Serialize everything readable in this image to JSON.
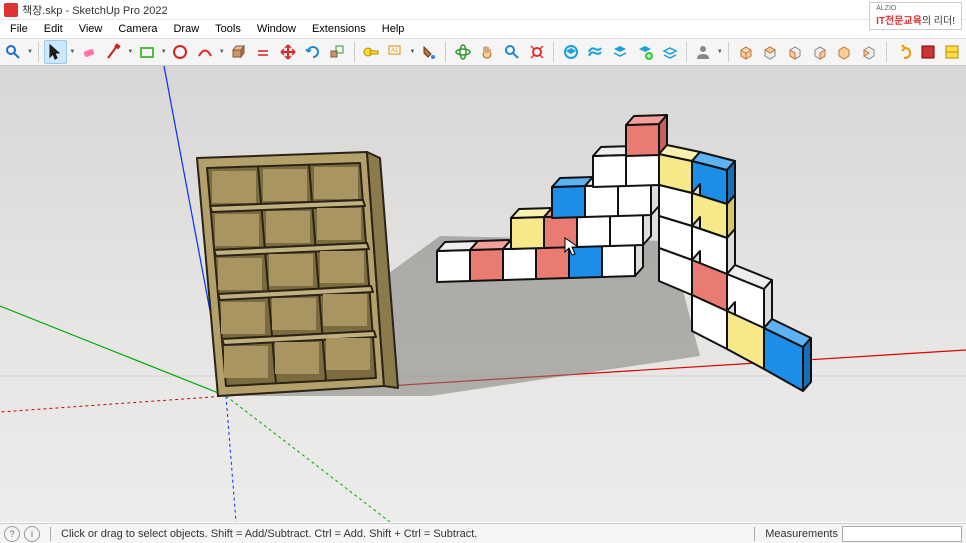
{
  "app": {
    "title": "책장.skp - SketchUp Pro 2022"
  },
  "watermark": {
    "small": "ALZIO",
    "brand": "IT전문교육",
    "tagline": "의 리더!"
  },
  "menu": {
    "items": [
      "File",
      "Edit",
      "View",
      "Camera",
      "Draw",
      "Tools",
      "Window",
      "Extensions",
      "Help"
    ]
  },
  "toolbar": {
    "icons": [
      "search-icon",
      "select-icon",
      "eraser-icon",
      "line-icon",
      "freehand-icon",
      "rectangle-icon",
      "circle-icon",
      "arc-icon",
      "arc2-icon",
      "arc3-icon",
      "polygon-icon",
      "pushpull-icon",
      "offset-icon",
      "move-icon",
      "rotate-icon",
      "scale-icon",
      "tape-icon",
      "text-icon",
      "dimension-icon",
      "paint-icon",
      "orbit-icon",
      "pan-icon",
      "zoom-icon",
      "zoom-extents-icon",
      "3dwarehouse-icon",
      "extension-icon",
      "layers-icon",
      "add-layer-icon",
      "outliner-icon",
      "user-icon",
      "home-icon",
      "iso-icon",
      "top-icon",
      "front-icon",
      "right-icon",
      "back-icon",
      "undo-icon",
      "redo-icon",
      "section-icon"
    ]
  },
  "status": {
    "hint": "Click or drag to select objects. Shift = Add/Subtract. Ctrl = Add. Shift + Ctrl = Subtract.",
    "measurements_label": "Measurements"
  }
}
